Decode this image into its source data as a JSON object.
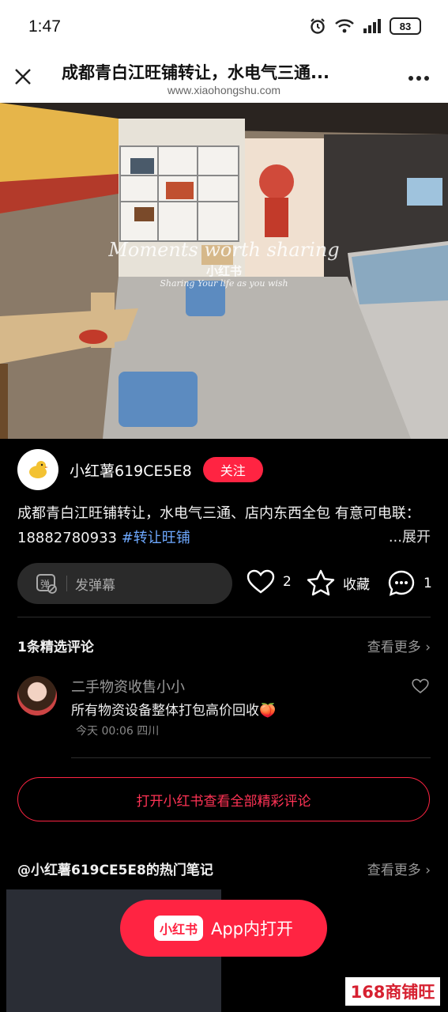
{
  "status_bar": {
    "time": "1:47",
    "battery": "83"
  },
  "header": {
    "title": "成都青白江旺铺转让，水电气三通...",
    "url": "www.xiaohongshu.com"
  },
  "photo": {
    "watermark_line1": "Moments worth sharing",
    "watermark_logo": "小红书",
    "watermark_line2": "Sharing Your life as you wish"
  },
  "author": {
    "name": "小红薯619CE5E8",
    "follow_label": "关注"
  },
  "post": {
    "text": "成都青白江旺铺转让，水电气三通、店内东西全包 有意可电联：18882780933 ",
    "tag": "#转让旺铺",
    "expand_label": "...展开"
  },
  "actions": {
    "danmu_placeholder": "发弹幕",
    "like_count": "2",
    "collect_label": "收藏",
    "comment_count": "1"
  },
  "comments_section": {
    "title": "1条精选评论",
    "see_more": "查看更多",
    "comment": {
      "user": "二手物资收售小小",
      "text": "所有物资设备整体打包高价回收🍑",
      "meta": "今天 00:06 四川"
    },
    "open_all_label": "打开小红书查看全部精彩评论"
  },
  "hot_notes": {
    "title": "@小红薯619CE5E8的热门笔记",
    "see_more": "查看更多"
  },
  "app_button": {
    "logo": "小红书",
    "label": "App内打开"
  },
  "corner_watermark": "168商铺旺"
}
